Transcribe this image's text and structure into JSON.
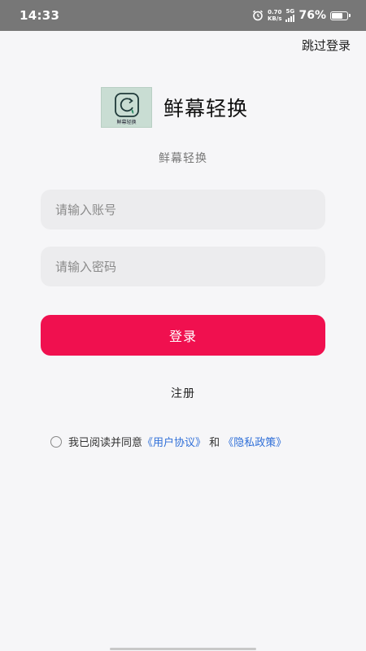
{
  "status_bar": {
    "time": "14:33",
    "net_speed_value": "0.70",
    "net_speed_unit": "KB/s",
    "network_type": "5G",
    "battery_percent": "76%",
    "battery_level": 0.76,
    "icons": [
      "alarm-icon",
      "signal-icon",
      "battery-icon"
    ]
  },
  "header": {
    "skip_label": "跳过登录"
  },
  "brand": {
    "logo_caption": "鲜幕轻换",
    "app_name": "鲜幕轻换",
    "subtitle": "鲜幕轻换",
    "logo_color": "#c9ddd3"
  },
  "form": {
    "account_placeholder": "请输入账号",
    "account_value": "",
    "password_placeholder": "请输入密码",
    "password_value": "",
    "login_label": "登录",
    "register_label": "注册",
    "accent_color": "#f0104f"
  },
  "agreement": {
    "prefix": "我已阅读并同意",
    "user_agreement": "《用户协议》",
    "conjunction": " 和 ",
    "privacy_policy": "《隐私政策》",
    "checked": false,
    "link_color": "#2f6fd8"
  }
}
